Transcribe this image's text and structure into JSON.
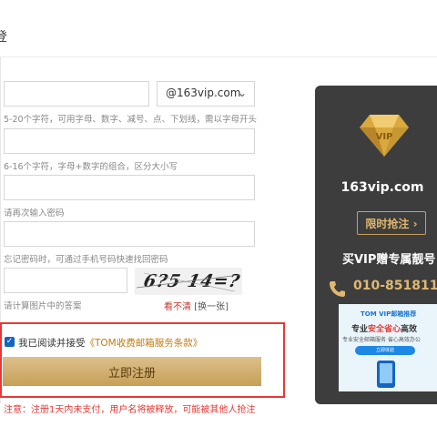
{
  "header": {
    "title": "登"
  },
  "form": {
    "email_domain": "@163vip.com",
    "username_hint": "5-20个字符，可用字母、数字、减号、点、下划线，需以字母开头",
    "password_hint": "6-16个字符，字母+数字的组合，区分大小写",
    "confirm_hint": "请再次输入密码",
    "phone_hint": "忘记密码时，可通过手机号码快速找回密码",
    "captcha_hint": "请计算图片中的答案",
    "captcha_text": "6?5 14=?",
    "refresh_label": "看不清",
    "refresh_link": "换一张"
  },
  "agreement": {
    "text": "我已阅读并接受",
    "link": "《TOM收费邮箱服务条款》",
    "checked": true
  },
  "register_button": "立即注册",
  "notice": "注意：注册1天内未支付，用户名将被释放，可能被其他人抢注",
  "promo": {
    "domain": "163vip.com",
    "limited_button": "限时抢注",
    "headline": "买VIP赠专属靓号",
    "phone": "010-851811",
    "banner": {
      "title": "TOM VIP邮箱推荐",
      "headline_1": "专业",
      "headline_hl": "安全省心",
      "headline_2": "高效",
      "subtitle": "专业安全邮箱服务 省心高效办公",
      "button": "立即体验"
    }
  },
  "colors": {
    "promo_bg": "#3d3d3d",
    "gold": "#e0b870",
    "button_gold": "#c79f58",
    "highlight_red": "#e53935",
    "checkbox_blue": "#1565c0"
  }
}
